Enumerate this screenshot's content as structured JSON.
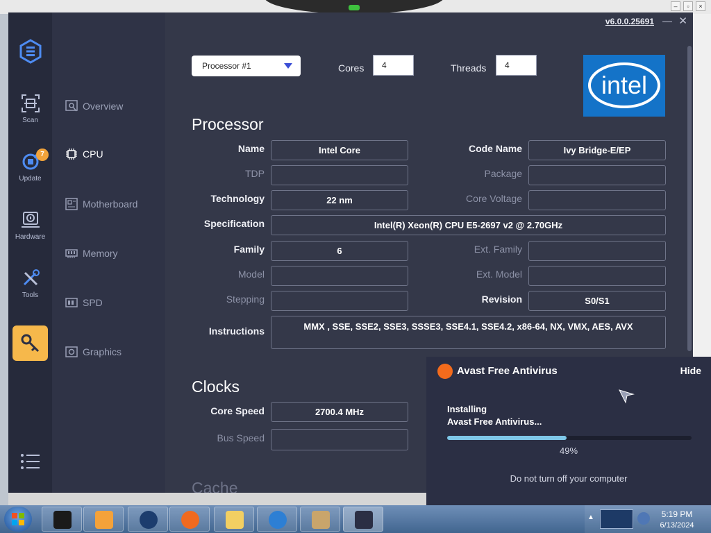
{
  "app": {
    "version": "v6.0.0.25691",
    "rail": {
      "scan": "Scan",
      "update": "Update",
      "update_badge": "7",
      "hardware": "Hardware",
      "tools": "Tools"
    },
    "subnav": [
      "Overview",
      "CPU",
      "Motherboard",
      "Memory",
      "SPD",
      "Graphics"
    ],
    "subnav_active": "CPU",
    "processor_select": "Processor #1",
    "cores_label": "Cores",
    "cores_value": "4",
    "threads_label": "Threads",
    "threads_value": "4",
    "logo_text": "intel",
    "processor_title": "Processor",
    "fields": {
      "name": {
        "label": "Name",
        "value": "Intel Core"
      },
      "code_name": {
        "label": "Code Name",
        "value": "Ivy Bridge-E/EP"
      },
      "tdp": {
        "label": "TDP",
        "value": ""
      },
      "package": {
        "label": "Package",
        "value": ""
      },
      "technology": {
        "label": "Technology",
        "value": "22 nm"
      },
      "core_voltage": {
        "label": "Core Voltage",
        "value": ""
      },
      "specification": {
        "label": "Specification",
        "value": "Intel(R) Xeon(R) CPU E5-2697 v2 @ 2.70GHz"
      },
      "family": {
        "label": "Family",
        "value": "6"
      },
      "ext_family": {
        "label": "Ext. Family",
        "value": ""
      },
      "model": {
        "label": "Model",
        "value": ""
      },
      "ext_model": {
        "label": "Ext. Model",
        "value": ""
      },
      "stepping": {
        "label": "Stepping",
        "value": ""
      },
      "revision": {
        "label": "Revision",
        "value": "S0/S1"
      },
      "instructions": {
        "label": "Instructions",
        "value": "MMX , SSE, SSE2, SSE3, SSSE3, SSE4.1, SSE4.2, x86-64, NX, VMX, AES, AVX"
      }
    },
    "clocks_title": "Clocks",
    "clocks": {
      "core_speed": {
        "label": "Core Speed",
        "value": "2700.4 MHz"
      },
      "bus_speed": {
        "label": "Bus Speed",
        "value": ""
      }
    },
    "cache_title": "Cache"
  },
  "popup": {
    "title": "Avast Free Antivirus",
    "hide": "Hide",
    "status_line1": "Installing",
    "status_line2": "Avast Free Antivirus...",
    "progress": 0.49,
    "progress_text": "49%",
    "warning": "Do not turn off your computer"
  },
  "taskbar": {
    "time": "5:19 PM",
    "date": "6/13/2024"
  },
  "colors": {
    "accent": "#f6b84b",
    "panel": "#343849",
    "rail": "#262a3b",
    "intel_blue": "#1473c8",
    "progress": "#7ec7e8"
  }
}
